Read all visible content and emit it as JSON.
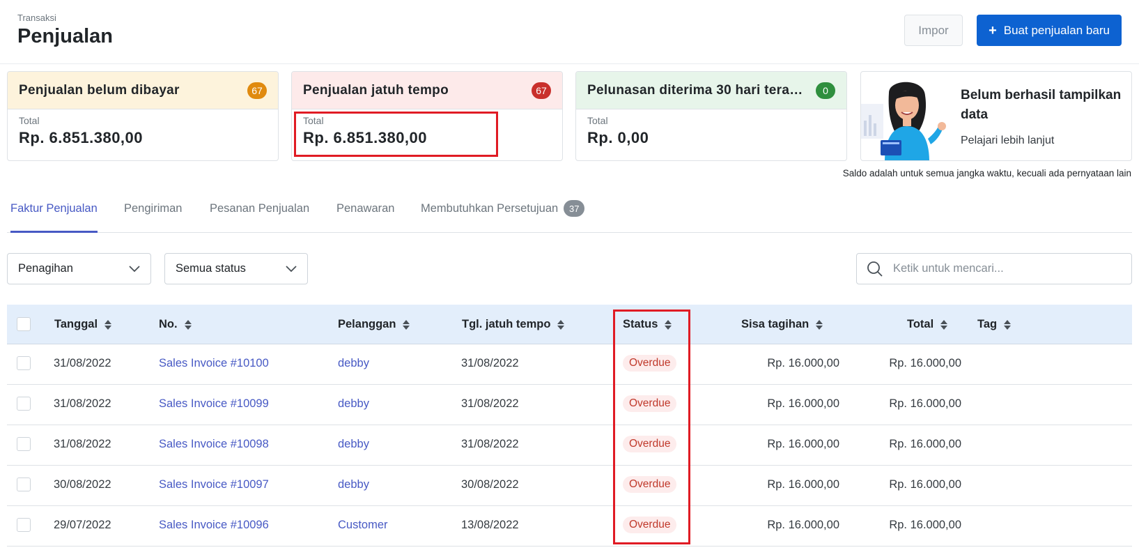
{
  "header": {
    "breadcrumb": "Transaksi",
    "title": "Penjualan",
    "import_label": "Impor",
    "new_label": "Buat penjualan baru",
    "new_icon": "plus-icon"
  },
  "cards": [
    {
      "title": "Penjualan belum dibayar",
      "count": "67",
      "total_label": "Total",
      "total_value": "Rp. 6.851.380,00",
      "head_bg": "#fdf3dc",
      "badge_color": "#e08a0f"
    },
    {
      "title": "Penjualan jatuh tempo",
      "count": "67",
      "total_label": "Total",
      "total_value": "Rp. 6.851.380,00",
      "head_bg": "#fdeaea",
      "badge_color": "#c9302c"
    },
    {
      "title": "Pelunasan diterima 30 hari terakhir",
      "count": "0",
      "total_label": "Total",
      "total_value": "Rp. 0,00",
      "head_bg": "#e7f5ea",
      "badge_color": "#2f8f3e"
    }
  ],
  "promo": {
    "title": "Belum berhasil tampilkan data",
    "link": "Pelajari lebih lanjut"
  },
  "note": "Saldo adalah untuk semua jangka waktu, kecuali ada pernyataan lain",
  "tabs": [
    {
      "label": "Faktur Penjualan",
      "active": true
    },
    {
      "label": "Pengiriman"
    },
    {
      "label": "Pesanan Penjualan"
    },
    {
      "label": "Penawaran"
    },
    {
      "label": "Membutuhkan Persetujuan",
      "badge": "37"
    }
  ],
  "filters": {
    "type_value": "Penagihan",
    "status_value": "Semua status",
    "search_placeholder": "Ketik untuk mencari..."
  },
  "table": {
    "columns": [
      "Tanggal",
      "No.",
      "Pelanggan",
      "Tgl. jatuh tempo",
      "Status",
      "Sisa tagihan",
      "Total",
      "Tag"
    ],
    "rows": [
      {
        "date": "31/08/2022",
        "no": "Sales Invoice #10100",
        "customer": "debby",
        "due": "31/08/2022",
        "status": "Overdue",
        "remaining": "Rp. 16.000,00",
        "total": "Rp. 16.000,00"
      },
      {
        "date": "31/08/2022",
        "no": "Sales Invoice #10099",
        "customer": "debby",
        "due": "31/08/2022",
        "status": "Overdue",
        "remaining": "Rp. 16.000,00",
        "total": "Rp. 16.000,00"
      },
      {
        "date": "31/08/2022",
        "no": "Sales Invoice #10098",
        "customer": "debby",
        "due": "31/08/2022",
        "status": "Overdue",
        "remaining": "Rp. 16.000,00",
        "total": "Rp. 16.000,00"
      },
      {
        "date": "30/08/2022",
        "no": "Sales Invoice #10097",
        "customer": "debby",
        "due": "30/08/2022",
        "status": "Overdue",
        "remaining": "Rp. 16.000,00",
        "total": "Rp. 16.000,00"
      },
      {
        "date": "29/07/2022",
        "no": "Sales Invoice #10096",
        "customer": "Customer",
        "due": "13/08/2022",
        "status": "Overdue",
        "remaining": "Rp. 16.000,00",
        "total": "Rp. 16.000,00"
      }
    ]
  },
  "colors": {
    "primary": "#0d62d1",
    "link": "#4759c4",
    "highlight": "#e01b24"
  }
}
